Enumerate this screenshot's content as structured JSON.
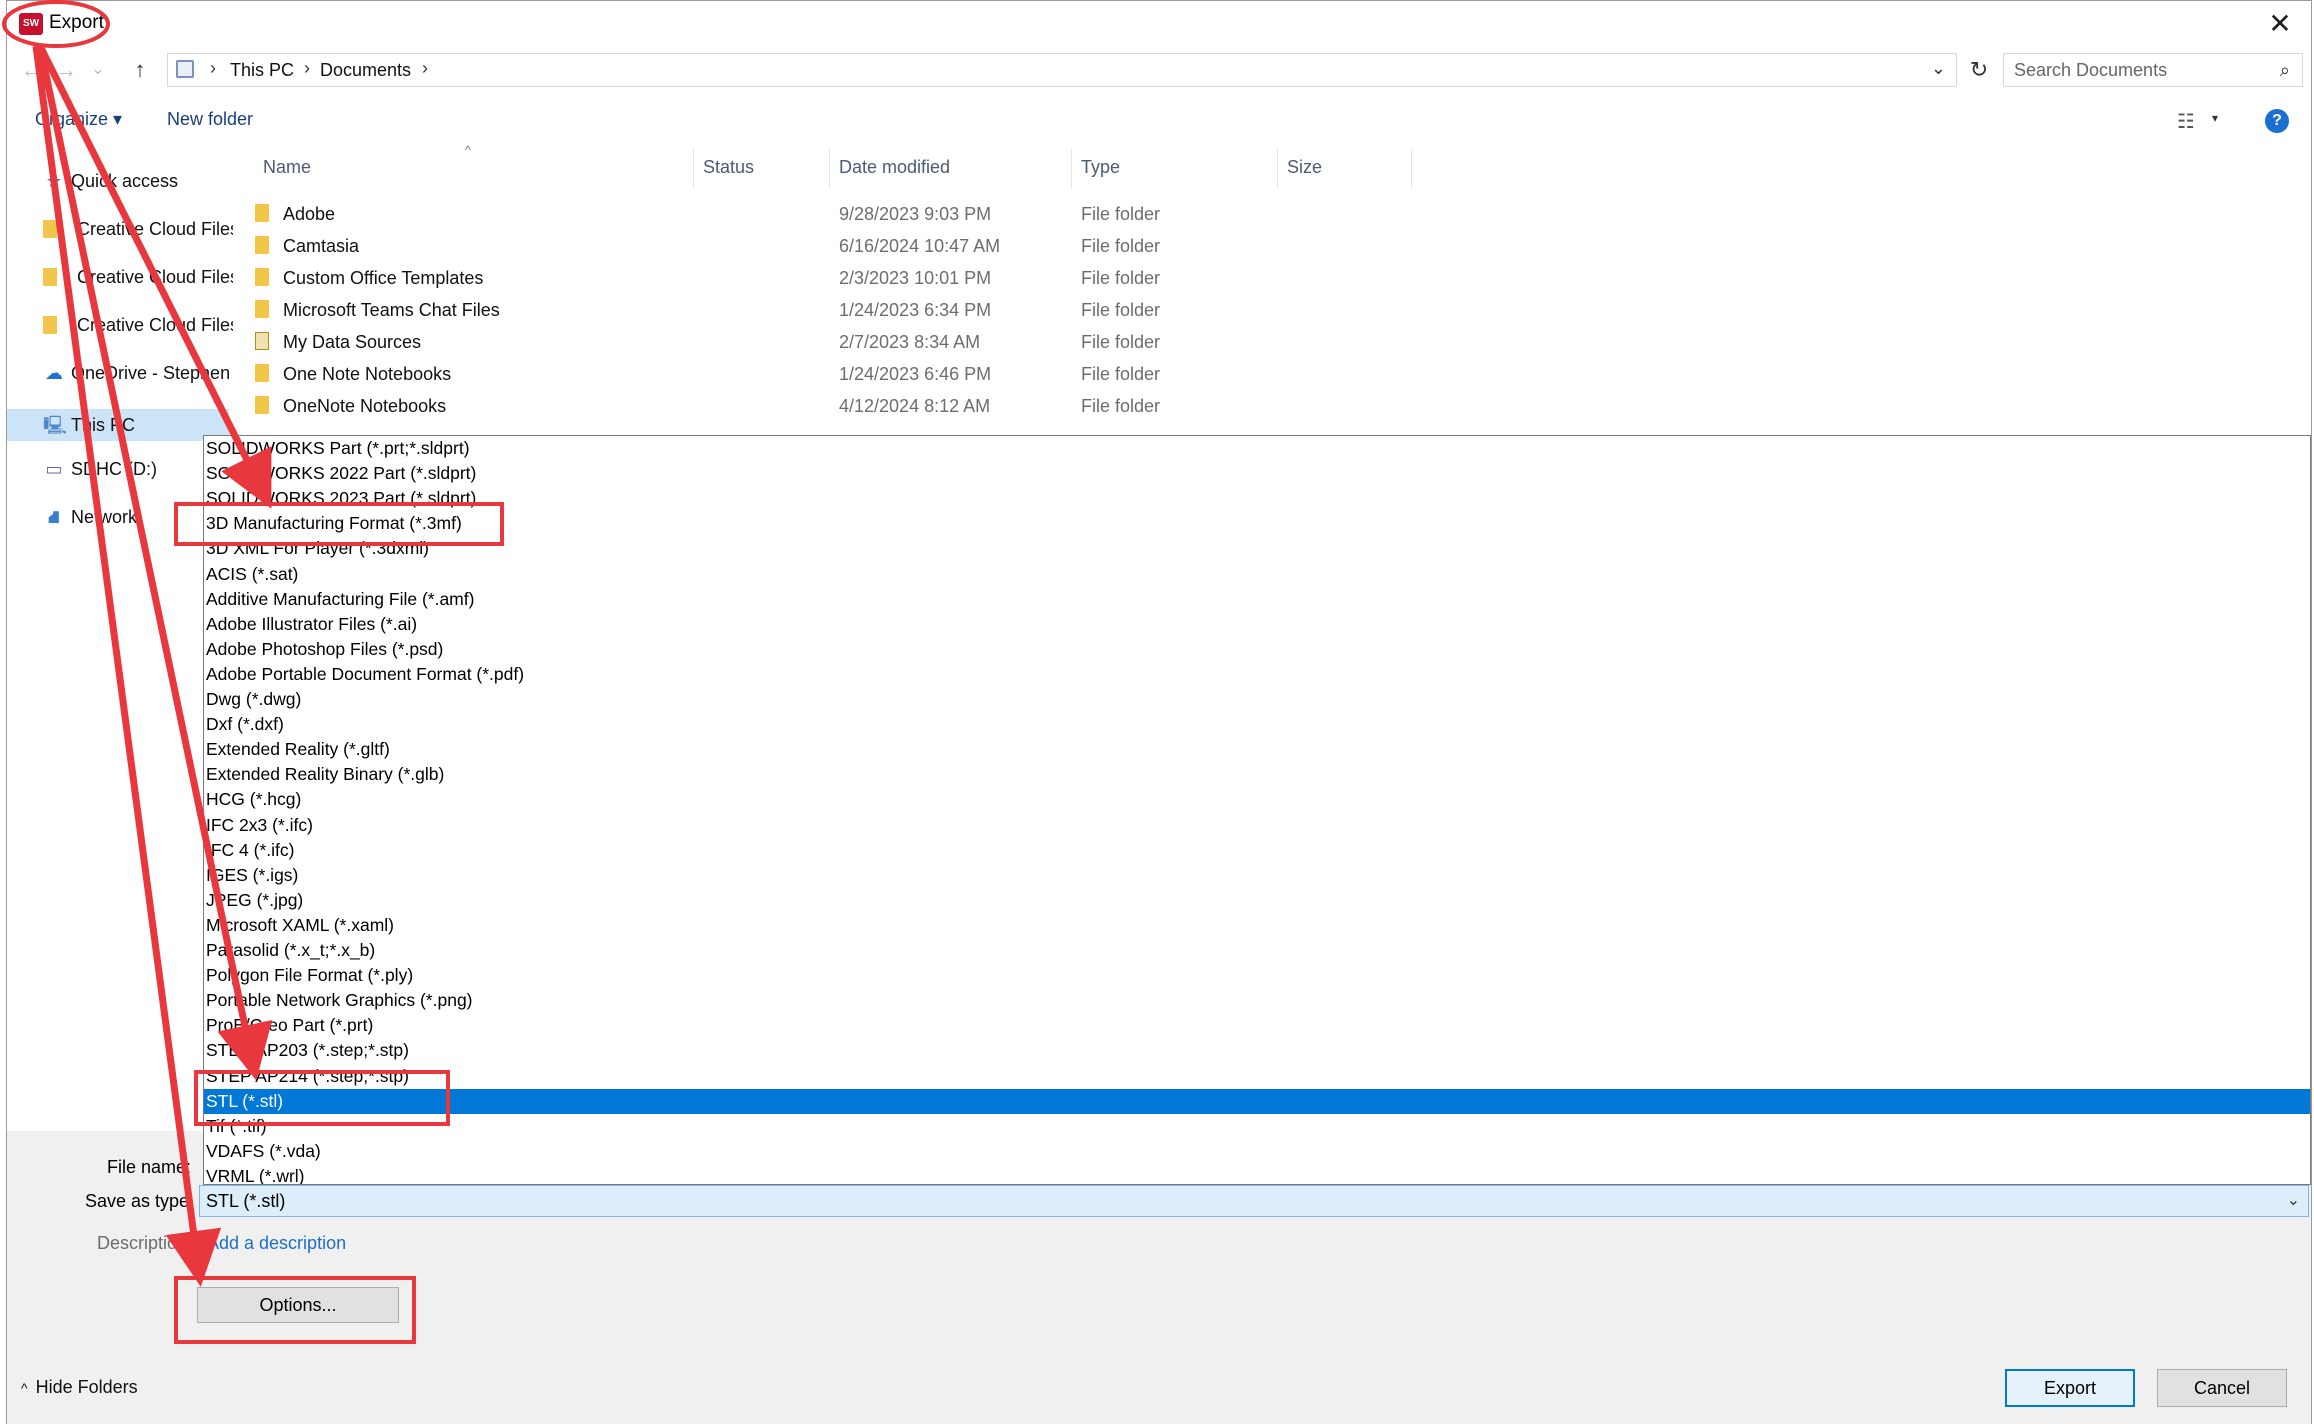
{
  "window": {
    "title": "Export",
    "app_icon": "solidworks-logo-icon",
    "close_glyph": "✕"
  },
  "nav": {
    "back_glyph": "←",
    "forward_glyph": "→",
    "recent_glyph": "⌄",
    "up_glyph": "↑",
    "breadcrumbs": [
      "This PC",
      "Documents"
    ],
    "separator": "›",
    "dropdown_glyph": "⌄",
    "refresh_glyph": "↻",
    "search_placeholder": "Search Documents",
    "search_glyph": "⌕"
  },
  "toolbar": {
    "organize": "Organize ▾",
    "new_folder": "New folder",
    "view_glyph": "☷",
    "view_dd_glyph": "▾",
    "help_glyph": "?"
  },
  "sidebar": {
    "items": [
      {
        "label": "Quick access",
        "icon": "star-icon",
        "glyph": "★"
      },
      {
        "label": "Creative Cloud Files",
        "icon": "folder-icon"
      },
      {
        "label": "Creative Cloud Files",
        "icon": "folder-icon"
      },
      {
        "label": "Creative Cloud Files",
        "icon": "folder-icon"
      },
      {
        "label": "OneDrive - Stephen",
        "icon": "cloud-icon",
        "glyph": "☁"
      },
      {
        "label": "This PC",
        "icon": "computer-icon",
        "glyph": "🖳"
      },
      {
        "label": "SDHC (D:)",
        "icon": "sd-card-icon",
        "glyph": "▭"
      },
      {
        "label": "Network",
        "icon": "network-icon",
        "glyph": "⛘"
      }
    ]
  },
  "columns": {
    "name": "Name",
    "status": "Status",
    "date_modified": "Date modified",
    "type": "Type",
    "size": "Size",
    "sort_glyph": "^"
  },
  "files": [
    {
      "name": "Adobe",
      "date": "9/28/2023 9:03 PM",
      "type": "File folder"
    },
    {
      "name": "Camtasia",
      "date": "6/16/2024 10:47 AM",
      "type": "File folder"
    },
    {
      "name": "Custom Office Templates",
      "date": "2/3/2023 10:01 PM",
      "type": "File folder"
    },
    {
      "name": "Microsoft Teams Chat Files",
      "date": "1/24/2023 6:34 PM",
      "type": "File folder"
    },
    {
      "name": "My Data Sources",
      "date": "2/7/2023 8:34 AM",
      "type": "File folder"
    },
    {
      "name": "One Note Notebooks",
      "date": "1/24/2023 6:46 PM",
      "type": "File folder"
    },
    {
      "name": "OneNote Notebooks",
      "date": "4/12/2024 8:12 AM",
      "type": "File folder"
    }
  ],
  "save_types": [
    "SOLIDWORKS Part (*.prt;*.sldprt)",
    "SOLIDWORKS 2022 Part (*.sldprt)",
    "SOLIDWORKS 2023 Part (*.sldprt)",
    "3D Manufacturing Format (*.3mf)",
    "3D XML For Player (*.3dxml)",
    "ACIS (*.sat)",
    "Additive Manufacturing File (*.amf)",
    "Adobe Illustrator Files (*.ai)",
    "Adobe Photoshop Files (*.psd)",
    "Adobe Portable Document Format (*.pdf)",
    "Dwg (*.dwg)",
    "Dxf (*.dxf)",
    "Extended Reality (*.gltf)",
    "Extended Reality Binary (*.glb)",
    "HCG (*.hcg)",
    "IFC 2x3 (*.ifc)",
    "IFC 4 (*.ifc)",
    "IGES (*.igs)",
    "JPEG (*.jpg)",
    "Microsoft XAML (*.xaml)",
    "Parasolid (*.x_t;*.x_b)",
    "Polygon File Format (*.ply)",
    "Portable Network Graphics (*.png)",
    "ProE/Creo Part (*.prt)",
    "STEP AP203 (*.step;*.stp)",
    "STEP AP214 (*.step;*.stp)",
    "STL (*.stl)",
    "Tif (*.tif)",
    "VDAFS (*.vda)",
    "VRML (*.wrl)"
  ],
  "selected_type_index": 26,
  "form": {
    "file_name_label": "File name:",
    "save_as_label": "Save as type:",
    "save_as_value": "STL (*.stl)",
    "save_as_dd_glyph": "⌄",
    "description_label": "Description:",
    "add_description": "Add a description",
    "options_button": "Options...",
    "hide_folders": "Hide Folders",
    "hide_chev_glyph": "^",
    "export_button": "Export",
    "cancel_button": "Cancel"
  },
  "colors": {
    "annotation": "#e8383d",
    "selection": "#0078d7",
    "link": "#1e6ec8"
  }
}
